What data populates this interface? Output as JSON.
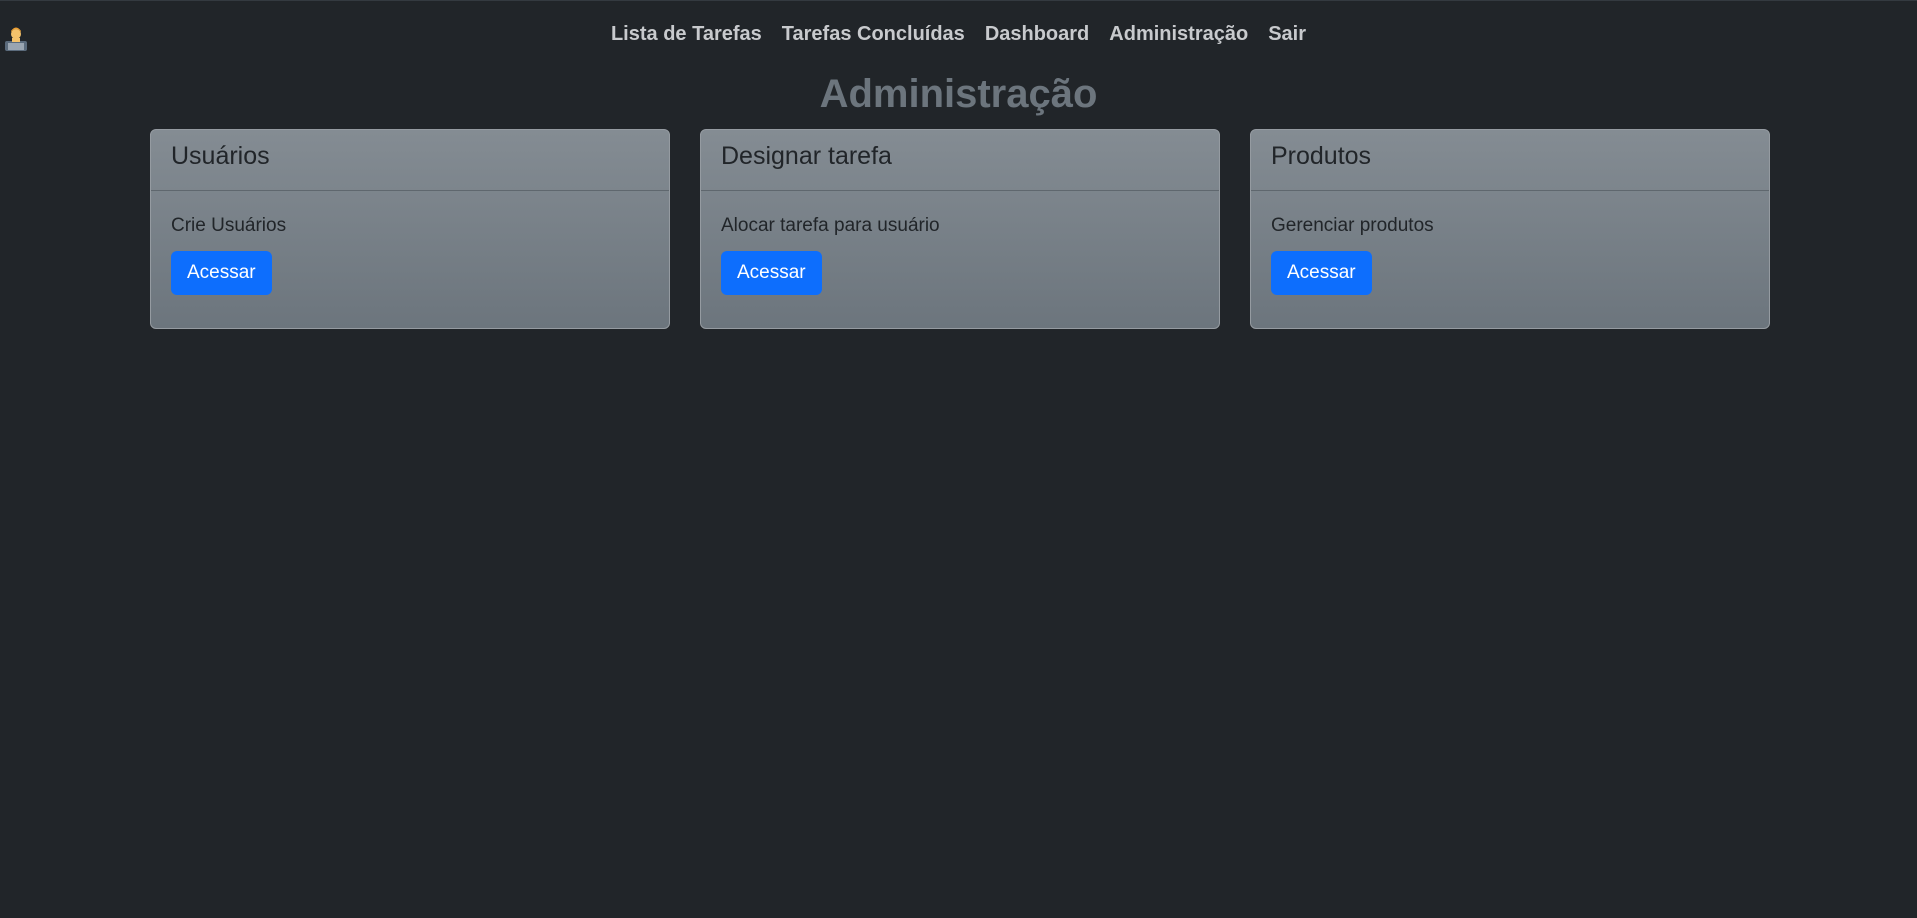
{
  "nav": {
    "brand_icon": "technologist-icon",
    "links": [
      {
        "label": "Lista de Tarefas"
      },
      {
        "label": "Tarefas Concluídas"
      },
      {
        "label": "Dashboard"
      },
      {
        "label": "Administração"
      },
      {
        "label": "Sair"
      }
    ]
  },
  "page": {
    "title": "Administração"
  },
  "cards": [
    {
      "title": "Usuários",
      "text": "Crie Usuários",
      "button": "Acessar"
    },
    {
      "title": "Designar tarefa",
      "text": "Alocar tarefa para usuário",
      "button": "Acessar"
    },
    {
      "title": "Produtos",
      "text": "Gerenciar produtos",
      "button": "Acessar"
    }
  ],
  "colors": {
    "background": "#212529",
    "nav_text": "#c8cacd",
    "title": "#6c757d",
    "card_bg": "#7a8289",
    "button": "#0d6efd"
  }
}
